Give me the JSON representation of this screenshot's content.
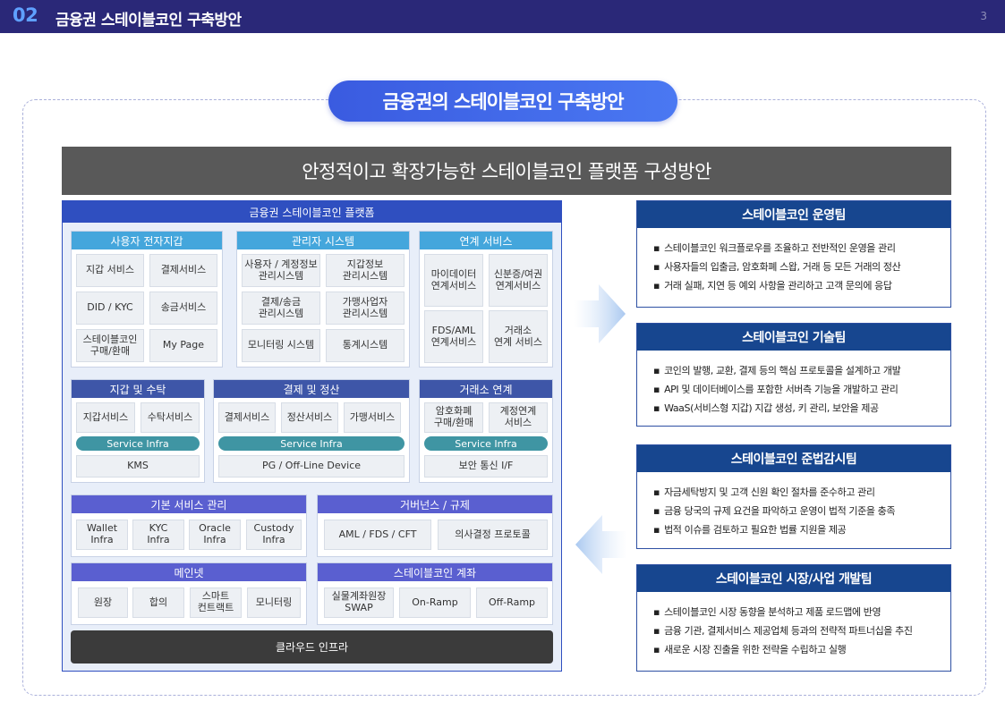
{
  "header": {
    "section_number": "02",
    "title": "금융권 스테이블코인 구축방안",
    "page_number": "3"
  },
  "pill_title": "금융권의 스테이블코인 구축방안",
  "banner_title": "안정적이고 확장가능한 스테이블코인 플랫폼 구성방안",
  "platform": {
    "title": "금융권 스테이블코인 플랫폼",
    "user_wallet": {
      "title": "사용자 전자지갑",
      "items": [
        "지갑 서비스",
        "결제서비스",
        "DID / KYC",
        "송금서비스",
        "스테이블코인\n구매/환매",
        "My Page"
      ]
    },
    "admin_system": {
      "title": "관리자 시스템",
      "items": [
        "사용자 / 계정정보\n관리시스템",
        "지갑정보\n관리시스템",
        "결제/송금\n관리시스템",
        "가맹사업자\n관리시스템",
        "모니터링 시스템",
        "통계시스템"
      ]
    },
    "linked_services": {
      "title": "연계 서비스",
      "items": [
        "마이데이터\n연계서비스",
        "신분증/여권\n연계서비스",
        "FDS/AML\n연계서비스",
        "거래소\n연계 서비스"
      ]
    },
    "wallet_custody": {
      "title": "지갑 및 수탁",
      "items": [
        "지갑서비스",
        "수탁서비스"
      ],
      "infra_label": "Service Infra",
      "bottom": "KMS"
    },
    "payment_settlement": {
      "title": "결제 및 정산",
      "items": [
        "결제서비스",
        "정산서비스",
        "가맹서비스"
      ],
      "infra_label": "Service Infra",
      "bottom": "PG / Off-Line Device"
    },
    "exchange_link": {
      "title": "거래소 연계",
      "items": [
        "암호화폐\n구매/환매",
        "계정연계\n서비스"
      ],
      "infra_label": "Service Infra",
      "bottom": "보안 통신 I/F"
    },
    "basic_service": {
      "title": "기본 서비스 관리",
      "items": [
        "Wallet\nInfra",
        "KYC\nInfra",
        "Oracle\nInfra",
        "Custody\nInfra"
      ]
    },
    "governance": {
      "title": "거버넌스  / 규제",
      "items": [
        "AML / FDS / CFT",
        "의사결정 프로토콜"
      ]
    },
    "mainnet": {
      "title": "메인넷",
      "items": [
        "원장",
        "합의",
        "스마트\n컨트랙트",
        "모니터링"
      ]
    },
    "account": {
      "title": "스테이블코인 계좌",
      "items": [
        "실물계좌원장\nSWAP",
        "On-Ramp",
        "Off-Ramp"
      ]
    },
    "cloud": "클라우드 인프라"
  },
  "teams": [
    {
      "title": "스테이블코인 운영팀",
      "bullets": [
        "스테이블코인 워크플로우를 조율하고 전반적인 운영을 관리",
        "사용자들의 입출금, 암호화폐 스왑, 거래 등 모든 거래의 정산",
        "거래 실패, 지연 등 예외 사항을 관리하고 고객 문의에 응답"
      ]
    },
    {
      "title": "스테이블코인 기술팀",
      "bullets": [
        "코인의 발행, 교환, 결제 등의 핵심 프로토콜을 설계하고 개발",
        "API 및 데이터베이스를  포함한 서버측 기능을 개발하고 관리",
        "WaaS(서비스형 지갑) 지갑 생성, 키 관리, 보안을 제공"
      ]
    },
    {
      "title": "스테이블코인 준법감시팀",
      "bullets": [
        "자금세탁방지 및 고객 신원 확인 절차를 준수하고 관리",
        "금융 당국의 규제 요건을 파악하고 운영이 법적 기준을 충족",
        "법적 이슈를 검토하고 필요한 법률 지원을 제공"
      ]
    },
    {
      "title": "스테이블코인 시장/사업 개발팀",
      "bullets": [
        "스테이블코인 시장 동향을 분석하고 제품 로드맵에 반영",
        "금융 기관, 결제서비스 제공업체 등과의 전략적 파트너십을 추진",
        "새로운 시장 진출을 위한 전략을 수립하고 실행"
      ]
    }
  ],
  "colors": {
    "header_bg": "#2a2878",
    "accent_blue": "#3a5be0",
    "team_header": "#17468f",
    "infra_teal": "#3f95a3"
  }
}
